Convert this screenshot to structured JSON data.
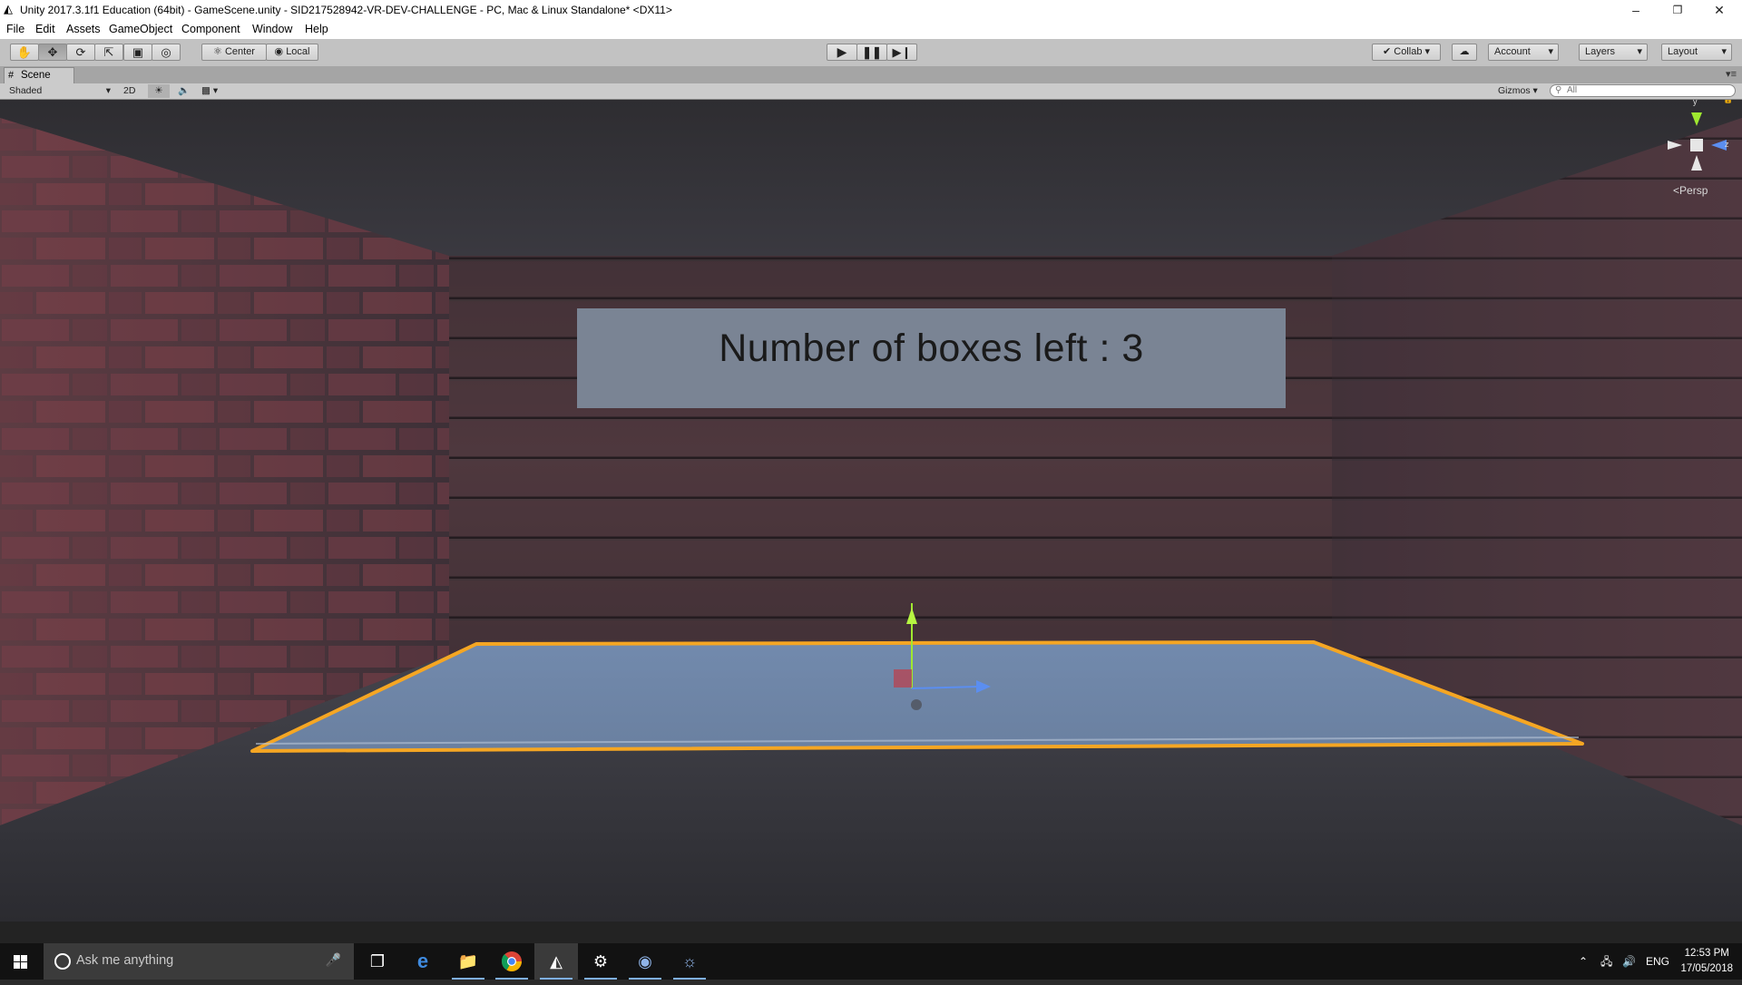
{
  "window": {
    "title": "Unity 2017.3.1f1 Education (64bit) - GameScene.unity - SID217528942-VR-DEV-CHALLENGE - PC, Mac & Linux Standalone* <DX11>",
    "controls": [
      "minimize",
      "restore",
      "close"
    ]
  },
  "menu": {
    "items": [
      "File",
      "Edit",
      "Assets",
      "GameObject",
      "Component",
      "Window",
      "Help"
    ]
  },
  "toolbar": {
    "tools": [
      "hand-tool",
      "move-tool",
      "rotate-tool",
      "scale-tool",
      "rect-tool",
      "transform-tool"
    ],
    "pivot_label": "Center",
    "space_label": "Local",
    "playback": [
      "play",
      "pause",
      "step"
    ],
    "collab_label": "Collab",
    "account_label": "Account",
    "layers_label": "Layers",
    "layout_label": "Layout"
  },
  "scene_tab": {
    "label": "Scene"
  },
  "scene_toolbar": {
    "shading_mode": "Shaded",
    "mode_2d": "2D",
    "gizmos_label": "Gizmos",
    "search_placeholder": "All"
  },
  "viewport": {
    "hud_text": "Number of boxes left : 3",
    "projection_label": "Persp",
    "axis_labels": {
      "y": "y",
      "z": "z"
    },
    "selection_color": "#f5a623",
    "plane_color": "#6f86a8"
  },
  "taskbar": {
    "search_placeholder": "Ask me anything",
    "apps": [
      "task-view",
      "edge",
      "file-explorer",
      "chrome",
      "unity",
      "steam",
      "app-7",
      "app-8"
    ],
    "language": "ENG",
    "time": "12:53 PM",
    "date": "17/05/2018"
  }
}
